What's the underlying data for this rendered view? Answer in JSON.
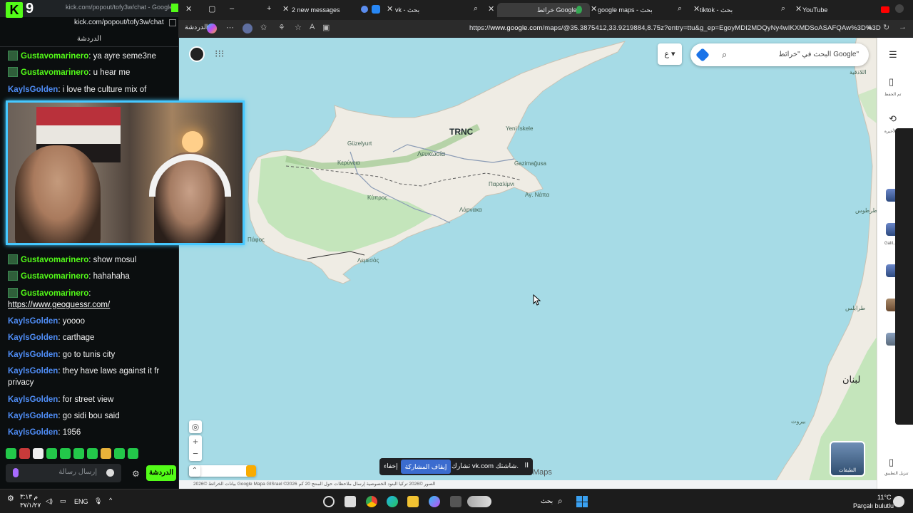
{
  "kick": {
    "title_url_small": "kick.com/popout/tofy3w/chat - Google...",
    "logo_letter": "K",
    "viewer_num": "9",
    "url": "kick.com/popout/tofy3w/chat",
    "chat_header": "الدردشة",
    "messages_top": [
      {
        "user": "Gustavomarinero",
        "text": "ya ayre seme3ne",
        "type": "g"
      },
      {
        "user": "Gustavomarinero",
        "text": "u hear me",
        "type": "g"
      },
      {
        "user": "KaylsGolden",
        "text": "i love the culture mix of",
        "type": "k"
      }
    ],
    "messages_bottom": [
      {
        "user": "Gustavomarinero",
        "text": "show mosul",
        "type": "g"
      },
      {
        "user": "Gustavomarinero",
        "text": "hahahaha",
        "type": "g"
      },
      {
        "user": "Gustavomarinero",
        "text": "",
        "type": "g"
      },
      {
        "user": "",
        "text": "https://www.geoguessr.com/",
        "type": "link"
      },
      {
        "user": "KaylsGolden",
        "text": "yoooo",
        "type": "k"
      },
      {
        "user": "KaylsGolden",
        "text": "carthage",
        "type": "k"
      },
      {
        "user": "KaylsGolden",
        "text": "go to tunis city",
        "type": "k"
      },
      {
        "user": "KaylsGolden",
        "text": "they have laws against it fr privacy",
        "type": "k"
      },
      {
        "user": "KaylsGolden",
        "text": "for street view",
        "type": "k"
      },
      {
        "user": "KaylsGolden",
        "text": "go sidi bou said",
        "type": "k"
      },
      {
        "user": "KaylsGolden",
        "text": "1956",
        "type": "k"
      }
    ],
    "input_placeholder": "إرسال رسالة",
    "chat_button": "الدردشة"
  },
  "browser": {
    "tabs": [
      {
        "label": "2 new messages",
        "active": false
      },
      {
        "label": "vk - بحث",
        "active": false
      },
      {
        "label": "خرائط Google",
        "active": true
      },
      {
        "label": "google maps - بحث",
        "active": false
      },
      {
        "label": "tiktok - بحث",
        "active": false
      },
      {
        "label": "YouTube",
        "active": false
      }
    ],
    "address_label": "الدردشة",
    "url_prefix": "https://",
    "url_host": "www.google.com",
    "url_rest": "/maps/@35.3875412,33.9219884,8.75z?entry=ttu&g_ep=EgoyMDI2MDQyNy4wIKXMDSoASAFQAw%3D%3D"
  },
  "map": {
    "search_placeholder": "البحث في \"خرائط Google\"",
    "lang_label": "ع",
    "labels": {
      "trnc": "TRNC",
      "lefkosia": "Λευκωσία",
      "kypros": "Κύπρος",
      "larnaka": "Λάρνακα",
      "lemesos": "Λεμεσός",
      "pafos": "Πάφος",
      "paralimni": "Παραλίμνι",
      "ayia_napa": "Αγ. Νάπα",
      "gazimagusa": "Gazimağusa",
      "yeni_iskele": "Yeni İskele",
      "kyrenia": "Κερύνεια",
      "guzelyurt": "Güzelyurt",
      "lebanon": "لبنان",
      "beirut": "بيروت",
      "tripoli": "طرابلس",
      "tartus": "طرطوس",
      "latakia": "اللاذقية"
    },
    "zoom_in": "+",
    "zoom_out": "−",
    "layers_label": "الطبقات",
    "maps_word": "Maps",
    "footer": "بيانات الخرائط ©2026 Google  Mapa GISrael ©2026  الصور ©2026   تركيا   البنود   الخصوصية   إرسال ملاحظات حول المنتج   20 كم",
    "share_message": "تشارك vk.com شاشتك.",
    "share_stop": "إيقاف المشاركة",
    "share_hide": "إخفاء",
    "share_pause": "II"
  },
  "side_panel": {
    "saved_label": "تم الحفظ",
    "recent_label": "الأخيرة",
    "galilee_label": "Galil...",
    "get_app_label": "تنزيل التطبيق"
  },
  "taskbar": {
    "time": "۳:۱۳ م",
    "date": "۳۷/۱/۲۷",
    "lang": "ENG",
    "search_placeholder": "بحث",
    "weather_temp": "11°C",
    "weather_desc": "Parçalı bulutlu"
  }
}
